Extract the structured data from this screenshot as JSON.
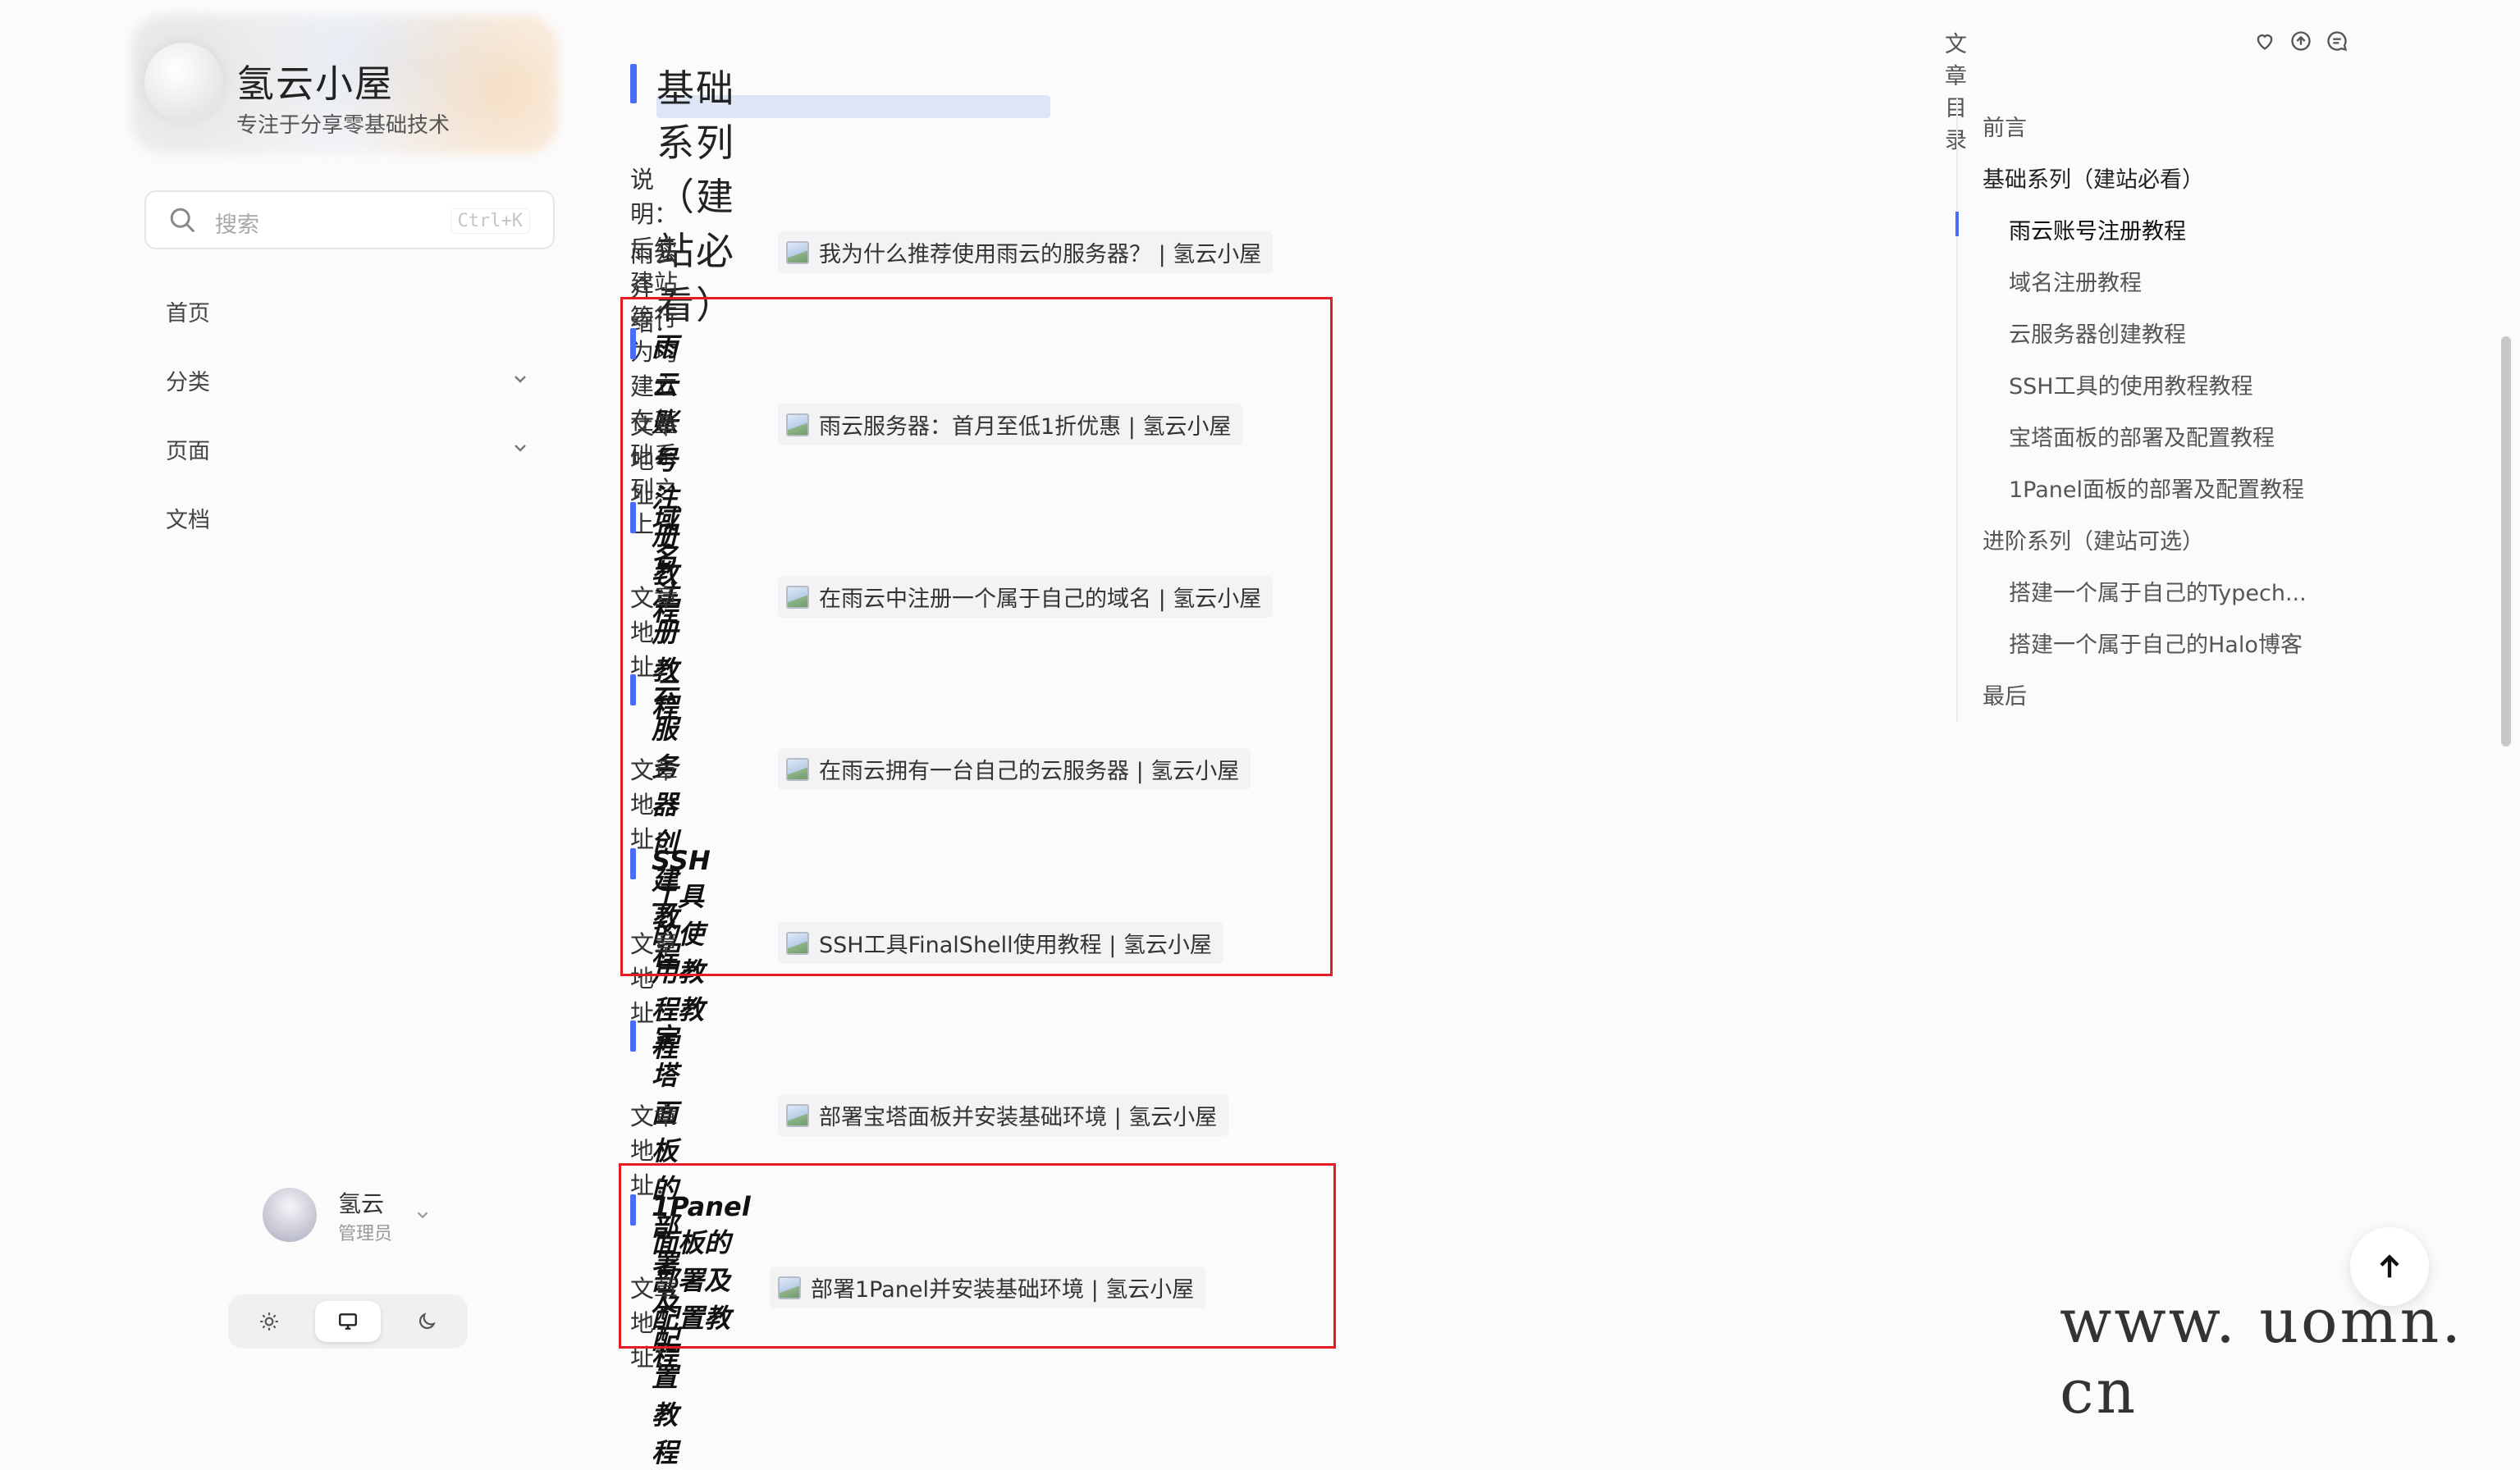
{
  "sidebar": {
    "site_title": "氢云小屋",
    "site_subtitle": "专注于分享零基础技术",
    "search": {
      "placeholder": "搜索",
      "shortcut": "Ctrl+K"
    },
    "nav": [
      {
        "label": "首页",
        "has_children": false
      },
      {
        "label": "分类",
        "has_children": true
      },
      {
        "label": "页面",
        "has_children": true
      },
      {
        "label": "文档",
        "has_children": false
      }
    ],
    "user": {
      "name": "氢云",
      "role": "管理员"
    },
    "theme_modes": [
      "sun-icon",
      "monitor-icon",
      "moon-icon"
    ],
    "theme_selected": "monitor-icon"
  },
  "main": {
    "title": "基础系列（建站必看）",
    "note": "说明：后续建站等行为均建立在基础系列之上",
    "intro_label": "雨云介绍：",
    "intro_link": "我为什么推荐使用雨云的服务器？ | 氢云小屋",
    "sections": [
      {
        "title": "雨云账号注册教程",
        "address_label": "文章地址：",
        "link": "雨云服务器：首月至低1折优惠 | 氢云小屋"
      },
      {
        "title": "域名注册教程",
        "address_label": "文章地址：",
        "link": "在雨云中注册一个属于自己的域名 | 氢云小屋"
      },
      {
        "title": "云服务器创建教程",
        "address_label": "文章地址：",
        "link": "在雨云拥有一台自己的云服务器 | 氢云小屋"
      },
      {
        "title": "SSH工具的使用教程教程",
        "address_label": "文章地址：",
        "link": "SSH工具FinalShell使用教程 | 氢云小屋"
      },
      {
        "title": "宝塔面板的部署及配置教程",
        "address_label": "文章地址：",
        "link": "部署宝塔面板并安装基础环境 | 氢云小屋"
      },
      {
        "title": "1Panel面板的部署及配置教程",
        "address_label": "文章地址：",
        "link": "部署1Panel并安装基础环境 | 氢云小屋"
      }
    ]
  },
  "toc": {
    "header": "文章目录",
    "actions": [
      "heart-icon",
      "arrow-up-circle-icon",
      "comment-icon"
    ],
    "items": [
      {
        "label": "前言",
        "level": 1
      },
      {
        "label": "基础系列（建站必看）",
        "level": 1
      },
      {
        "label": "雨云账号注册教程",
        "level": 2,
        "active": true
      },
      {
        "label": "域名注册教程",
        "level": 2
      },
      {
        "label": "云服务器创建教程",
        "level": 2
      },
      {
        "label": "SSH工具的使用教程教程",
        "level": 2
      },
      {
        "label": "宝塔面板的部署及配置教程",
        "level": 2
      },
      {
        "label": "1Panel面板的部署及配置教程",
        "level": 2
      },
      {
        "label": "进阶系列（建站可选）",
        "level": 1
      },
      {
        "label": "搭建一个属于自己的Typech...",
        "level": 2
      },
      {
        "label": "搭建一个属于自己的Halo博客",
        "level": 2
      },
      {
        "label": "最后",
        "level": 1
      }
    ]
  },
  "watermark": "www. uomn. cn",
  "colors": {
    "accent": "#4a6cf7",
    "highlight_box": "#e41c24",
    "background": "#fbfbfc"
  }
}
